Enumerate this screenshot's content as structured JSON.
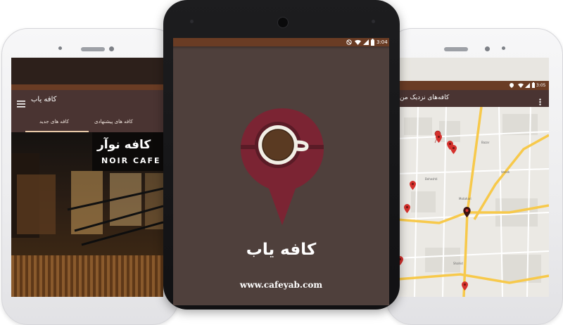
{
  "colors": {
    "brand_dark": "#4f403c",
    "status_bar": "#6a3c24",
    "toolbar": "#4a3432",
    "logo_pin": "#7b2433",
    "cup": "#f2efe6",
    "coffee": "#5a3a22",
    "map_pin": "#d5312d",
    "map_road": "#f7c94b"
  },
  "center": {
    "status_time": "3:04",
    "status_icons": [
      "mute-icon",
      "wifi-icon",
      "signal-icon",
      "battery-icon"
    ],
    "app_name": "کافه یاب",
    "website": "www.cafeyab.com"
  },
  "left": {
    "toolbar_title": "کافه یاب",
    "menu_icon": "hamburger-icon",
    "tabs": [
      "کافه های جدید",
      "کافه های پیشنهادی"
    ],
    "photo_sign": "کافه نوآر",
    "photo_sign_sub": "NOIR CAFE"
  },
  "right": {
    "status_time": "3:05",
    "toolbar_title": "کافه‌های نزدیک من",
    "overflow_icon": "more-vert-icon",
    "map_labels": [
      "Beheshti",
      "Shahid",
      "Motahari",
      "Bazar",
      "Vanak"
    ]
  }
}
